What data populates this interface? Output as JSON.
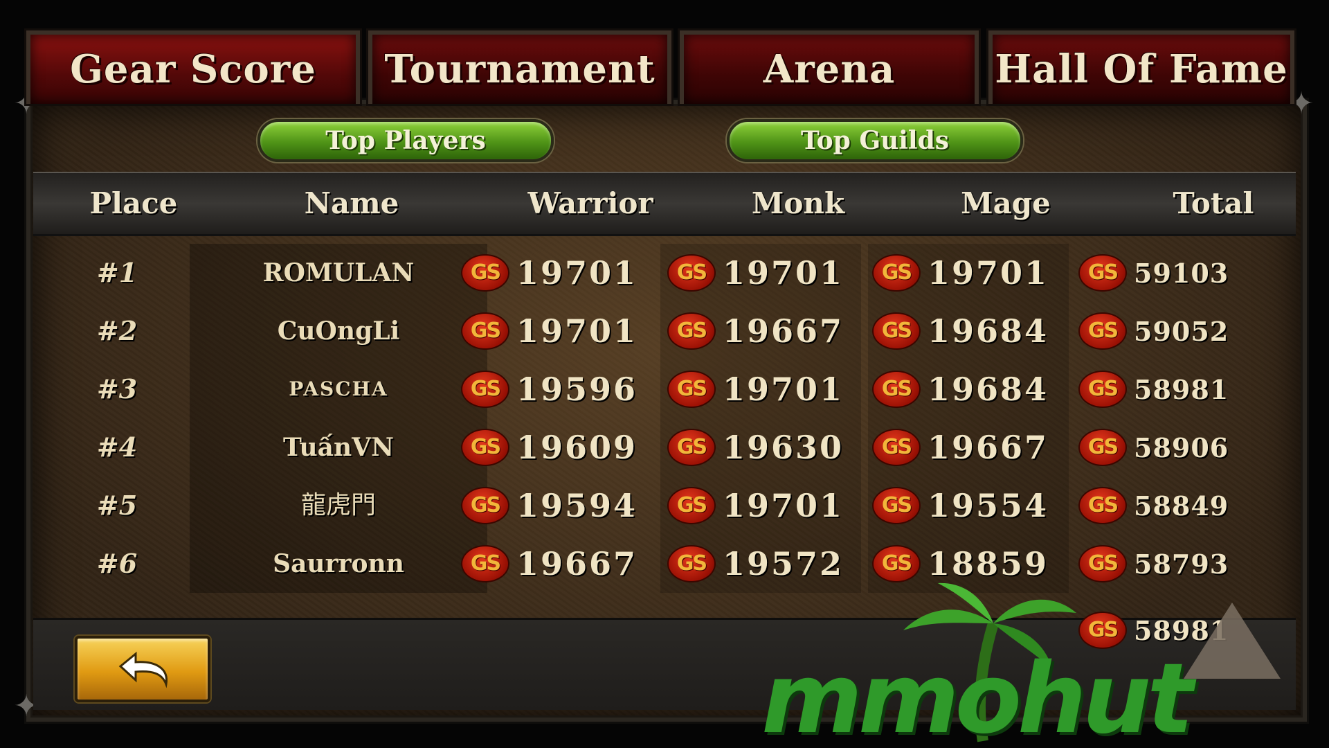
{
  "tabs": [
    {
      "label": "Gear Score"
    },
    {
      "label": "Tournament"
    },
    {
      "label": "Arena"
    },
    {
      "label": "Hall Of Fame"
    }
  ],
  "subtabs": {
    "top_players": "Top Players",
    "top_guilds": "Top Guilds"
  },
  "columns": {
    "place": "Place",
    "name": "Name",
    "warrior": "Warrior",
    "monk": "Monk",
    "mage": "Mage",
    "total": "Total"
  },
  "gs_badge": "GS",
  "rows": [
    {
      "place": "#1",
      "name": "ROMULAN",
      "warrior": "19701",
      "monk": "19701",
      "mage": "19701",
      "total": "59103"
    },
    {
      "place": "#2",
      "name": "CuOngLi",
      "warrior": "19701",
      "monk": "19667",
      "mage": "19684",
      "total": "59052"
    },
    {
      "place": "#3",
      "name": "PASCHA",
      "warrior": "19596",
      "monk": "19701",
      "mage": "19684",
      "total": "58981"
    },
    {
      "place": "#4",
      "name": "TuấnVN",
      "warrior": "19609",
      "monk": "19630",
      "mage": "19667",
      "total": "58906"
    },
    {
      "place": "#5",
      "name": "龍虎門",
      "warrior": "19594",
      "monk": "19701",
      "mage": "19554",
      "total": "58849"
    },
    {
      "place": "#6",
      "name": "Saurronn",
      "warrior": "19667",
      "monk": "19572",
      "mage": "18859",
      "total": "58793"
    }
  ],
  "partial_row_total": "58981",
  "back_button_icon": "back-arrow-icon",
  "watermark_text": "mmohut",
  "colors": {
    "tab_red": "#6b0c0c",
    "button_green": "#4f9317",
    "gs_red": "#c0220c",
    "text_cream": "#eadcb8",
    "back_gold": "#e09a12"
  }
}
